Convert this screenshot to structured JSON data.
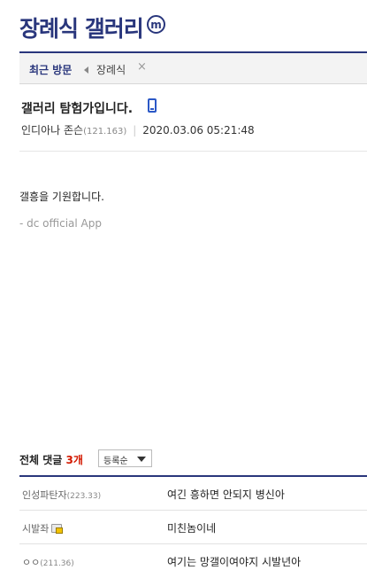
{
  "header": {
    "gallery_title": "장례식 갤러리",
    "badge": "m"
  },
  "recent": {
    "label": "최근 방문",
    "items": [
      {
        "label": "장례식",
        "close": "×"
      }
    ]
  },
  "post": {
    "title": "갤러리 탐험가입니다.",
    "author": "인디아나 존슨",
    "author_ip": "(121.163)",
    "date": "2020.03.06 05:21:48",
    "body": "갤흥을 기원합니다.",
    "signature": "- dc official App"
  },
  "comments": {
    "label": "전체 댓글",
    "count": "3개",
    "sort_option": "등록순",
    "items": [
      {
        "author": "인성파탄자",
        "ip": "(223.33)",
        "member": false,
        "text": "여긴 흥하면 안되지 병신아"
      },
      {
        "author": "시발좌",
        "ip": "",
        "member": true,
        "text": "미친놈이네"
      },
      {
        "author": "ㅇㅇ",
        "ip": "(211.36)",
        "member": false,
        "text": "여기는 망갤이여야지 시발년아"
      }
    ]
  },
  "colors": {
    "brand": "#29367c",
    "count_red": "#d31900",
    "mobile_icon": "#2b58c6"
  },
  "icons": {
    "mobile": "mobile-icon",
    "member": "member-icon",
    "back": "triangle-left-icon",
    "close": "close-icon",
    "sort": "chevron-down-icon"
  }
}
